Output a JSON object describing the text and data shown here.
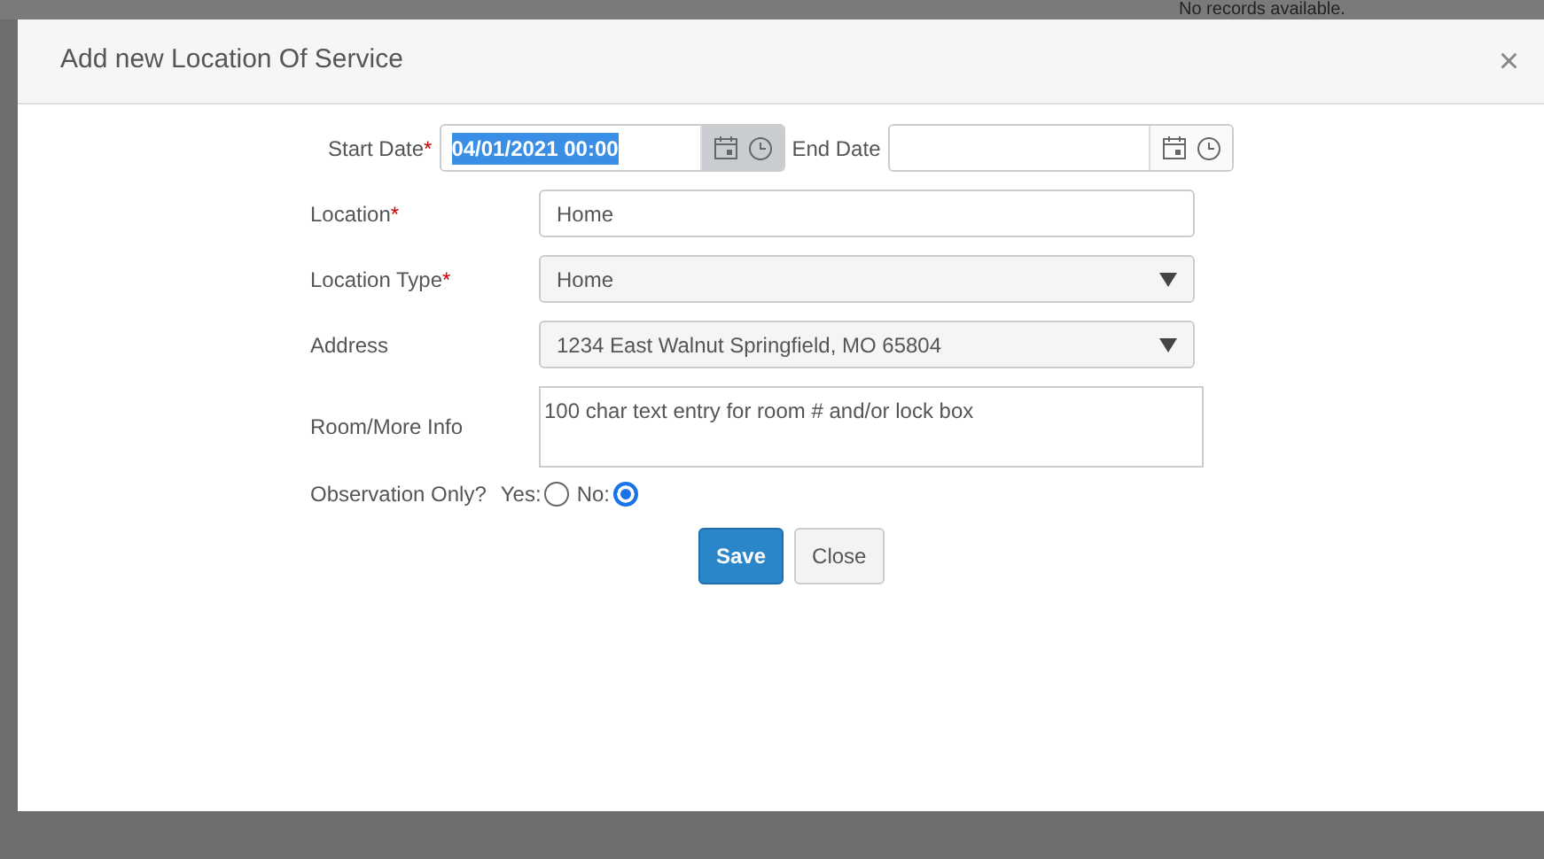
{
  "background": {
    "text": "No records available."
  },
  "dialog": {
    "title": "Add new Location Of Service",
    "close": "×"
  },
  "date_fields": [
    {
      "label": "Start Date",
      "required_mark": "*",
      "value": "04/01/2021 00:00",
      "focused": true
    },
    {
      "label": "End Date",
      "focused": false
    }
  ],
  "fields": [
    {
      "kind": "text",
      "label": "Location",
      "required_mark": "*",
      "value": "Home"
    },
    {
      "kind": "select",
      "label": "Location Type",
      "required_mark": "*",
      "value": "Home"
    },
    {
      "kind": "select",
      "label": "Address",
      "value": "1234 East Walnut Springfield, MO 65804"
    },
    {
      "kind": "textarea",
      "label": "Room/More Info",
      "value": "100 char text entry for room # and/or lock box"
    }
  ],
  "observation": {
    "label": "Observation Only?",
    "options": [
      {
        "label": "Yes:",
        "selected": false
      },
      {
        "label": "No:",
        "selected": true
      }
    ]
  },
  "buttons": [
    {
      "label": "Save",
      "kind": "primary"
    },
    {
      "label": "Close",
      "kind": "secondary"
    }
  ]
}
